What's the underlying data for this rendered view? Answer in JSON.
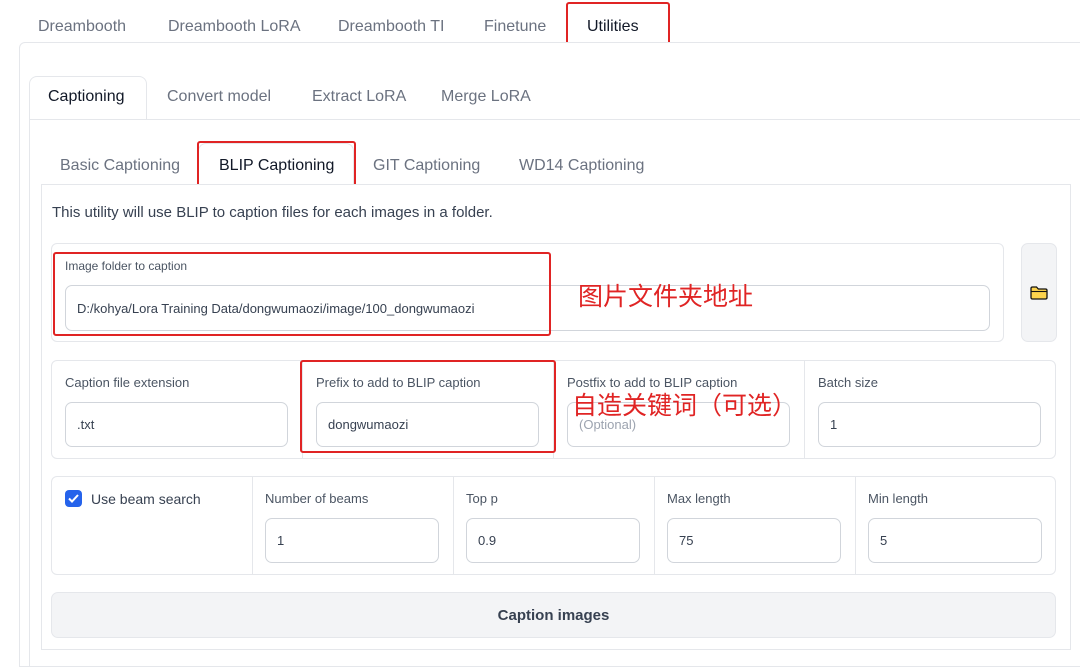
{
  "top_tabs": [
    "Dreambooth",
    "Dreambooth LoRA",
    "Dreambooth TI",
    "Finetune",
    "Utilities"
  ],
  "sub_tabs": [
    "Captioning",
    "Convert model",
    "Extract LoRA",
    "Merge LoRA"
  ],
  "caption_tabs": [
    "Basic Captioning",
    "BLIP Captioning",
    "GIT Captioning",
    "WD14 Captioning"
  ],
  "description": "This utility will use BLIP to caption files for each images in a folder.",
  "image_folder": {
    "label": "Image folder to caption",
    "value": "D:/kohya/Lora Training Data/dongwumaozi/image/100_dongwumaozi"
  },
  "caption_ext": {
    "label": "Caption file extension",
    "value": ".txt"
  },
  "prefix": {
    "label": "Prefix to add to BLIP caption",
    "value": "dongwumaozi"
  },
  "postfix": {
    "label": "Postfix to add to BLIP caption",
    "placeholder": "(Optional)"
  },
  "batch_size": {
    "label": "Batch size",
    "value": "1"
  },
  "beam_search": {
    "label": "Use beam search",
    "checked": true
  },
  "num_beams": {
    "label": "Number of beams",
    "value": "1"
  },
  "top_p": {
    "label": "Top p",
    "value": "0.9"
  },
  "max_length": {
    "label": "Max length",
    "value": "75"
  },
  "min_length": {
    "label": "Min length",
    "value": "5"
  },
  "caption_button": "Caption images",
  "annotations": {
    "folder_note": "图片文件夹地址",
    "keyword_note": "自造关键词（可选）"
  },
  "colors": {
    "accent": "#2563eb",
    "annotation_red": "#e02424"
  },
  "icons": {
    "folder_button": "folder-icon",
    "checkbox": "check-icon"
  }
}
